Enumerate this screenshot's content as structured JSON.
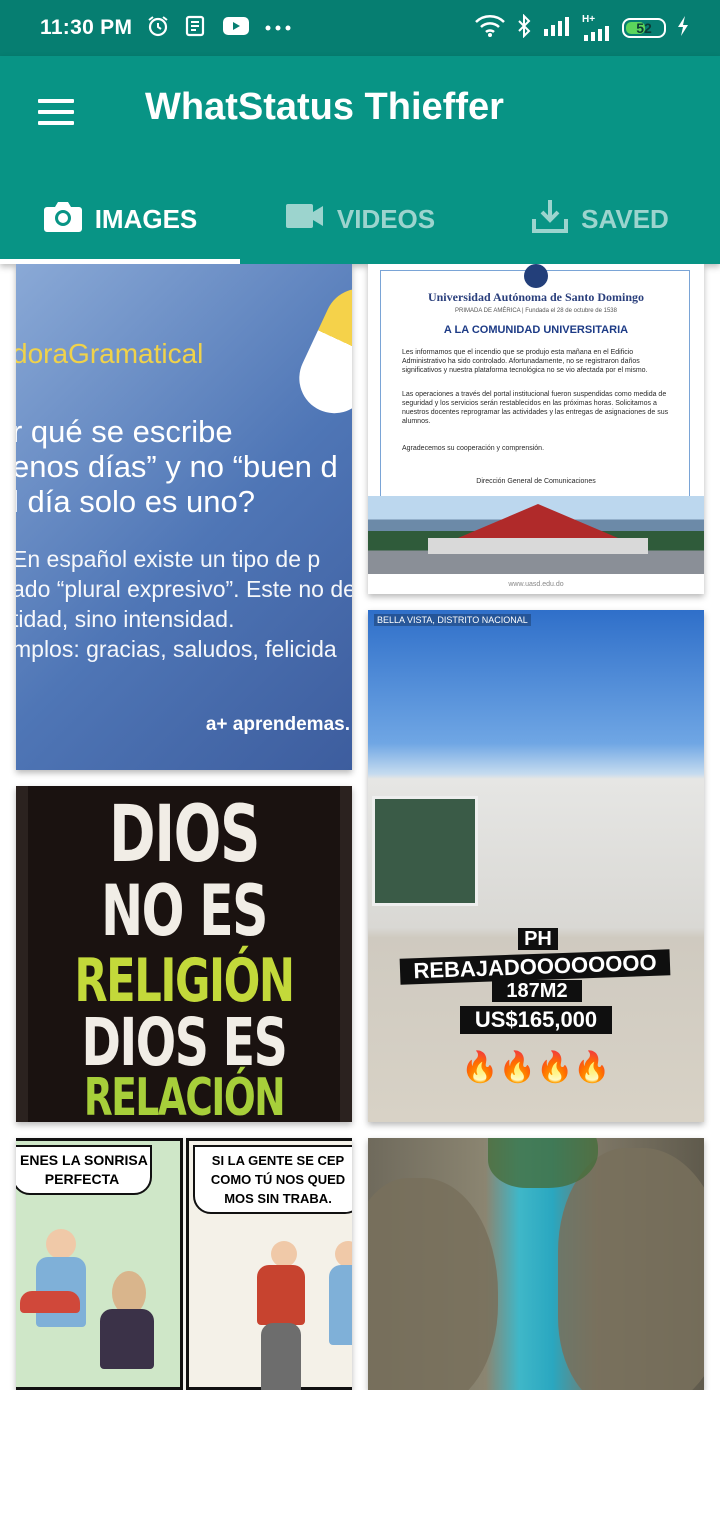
{
  "status_bar": {
    "time": "11:30 PM",
    "left_icons": [
      "alarm-icon",
      "news-icon",
      "youtube-icon",
      "more-dots-icon"
    ],
    "right_icons": [
      "wifi-icon",
      "bluetooth-icon",
      "signal-icon",
      "signal-hplus-icon"
    ],
    "network_label": "H+",
    "battery_percent": "52",
    "battery_level": 0.52,
    "charging": true
  },
  "app_bar": {
    "title": "WhatStatus Thieffer",
    "color": "#089485"
  },
  "tabs": [
    {
      "label": "IMAGES",
      "icon": "camera-icon",
      "active": true
    },
    {
      "label": "VIDEOS",
      "icon": "videocam-icon",
      "active": false
    },
    {
      "label": "SAVED",
      "icon": "download-icon",
      "active": false
    }
  ],
  "images": {
    "grammar": {
      "brand": "doraGramatical",
      "question": "r qué se escribe\nenos días” y no “buen d\nl día solo es uno?",
      "body": "En español existe un tipo de p\nado “plural expresivo”. Este no de\ntidad, sino intensidad.\nmplos: gracias, saludos, felicida",
      "logo": "a+ aprendemas."
    },
    "uasd": {
      "name": "Universidad Autónoma de Santo Domingo",
      "subtitle": "PRIMADA DE AMÉRICA | Fundada el 28 de octubre de 1538",
      "heading": "A LA COMUNIDAD UNIVERSITARIA",
      "paragraph_1": "Les informamos que el incendio que se produjo esta mañana en el Edificio Administrativo ha sido controlado. Afortunadamente, no se registraron daños significativos y nuestra plataforma tecnológica no se vio afectada por el mismo.",
      "paragraph_2": "Las operaciones a través del portal institucional fueron suspendidas como medida de seguridad y los servicios serán restablecidos en las próximas horas. Solicitamos a nuestros docentes reprogramar las actividades y las entregas de asignaciones de sus alumnos.",
      "paragraph_3": "Agradecemos su cooperación y comprensión.",
      "signature": "Dirección General de Comunicaciones",
      "url": "www.uasd.edu.do"
    },
    "dios": {
      "line_1": "DIOS",
      "line_2": "NO ES",
      "line_3": "RELIGIÓN",
      "line_4": "DIOS ES",
      "line_5": "RELACIÓN"
    },
    "ph": {
      "location": "BELLA VISTA, DISTRITO NACIONAL",
      "line_1": "PH",
      "line_2": "REBAJADOOOOOOOO",
      "line_3": "187M2",
      "line_4": "US$165,000",
      "emoji": "🔥🔥🔥🔥"
    },
    "comic": {
      "bubble_1": "ENES LA SONRISA\nPERFECTA",
      "bubble_2": "SI LA GENTE SE CEP\nCOMO TÚ NOS QUED\nMOS SIN TRABA."
    }
  }
}
